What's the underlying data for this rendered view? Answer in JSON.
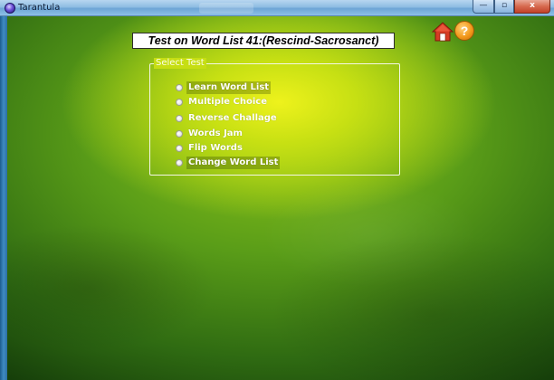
{
  "window": {
    "title": "Tarantula",
    "minimize_label": "—",
    "maximize_label": "▫",
    "close_label": "x"
  },
  "page": {
    "title": "Test on Word List 41:(Rescind-Sacrosanct)"
  },
  "toolbar": {
    "help_label": "?"
  },
  "select_test": {
    "legend": "Select Test",
    "options": [
      {
        "label": "Learn Word List"
      },
      {
        "label": "Multiple Choice"
      },
      {
        "label": "Reverse Challage"
      },
      {
        "label": "Words Jam"
      },
      {
        "label": "Flip Words"
      },
      {
        "label": "Change Word List"
      }
    ]
  },
  "icons": {
    "home": "home-icon",
    "help": "help-icon",
    "app": "tarantula-app-icon"
  },
  "colors": {
    "home_red": "#d63b24",
    "help_orange": "#f39a1c"
  }
}
